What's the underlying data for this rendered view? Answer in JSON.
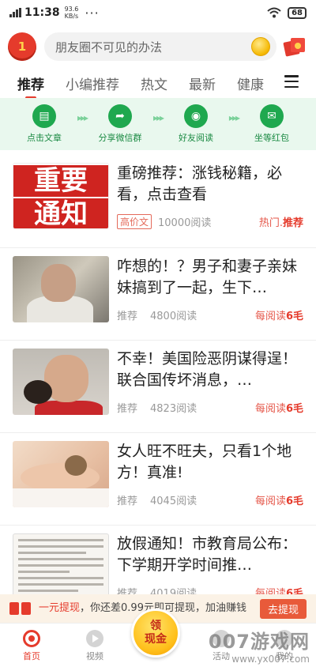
{
  "status_bar": {
    "time": "11:38",
    "net_speed": "93.6",
    "net_unit": "KB/s",
    "dots": "···",
    "battery": "68"
  },
  "header": {
    "logo_text": "1",
    "search_placeholder": "朋友圈不可见的办法"
  },
  "tabs": [
    {
      "label": "推荐",
      "active": true
    },
    {
      "label": "小编推荐"
    },
    {
      "label": "热文"
    },
    {
      "label": "最新"
    },
    {
      "label": "健康"
    }
  ],
  "steps": [
    {
      "label": "点击文章",
      "icon": "document-icon"
    },
    {
      "label": "分享微信群",
      "icon": "share-icon"
    },
    {
      "label": "好友阅读",
      "icon": "eye-icon"
    },
    {
      "label": "坐等红包",
      "icon": "redpacket-icon"
    }
  ],
  "feed": [
    {
      "title": "重磅推荐：涨钱秘籍，必看，点击查看",
      "thumb_text_1": "重要",
      "thumb_text_2": "通知",
      "tag": "高价文",
      "reads": "10000阅读",
      "reward_prefix": "热门.",
      "reward_bold": "推荐"
    },
    {
      "title": "咋想的！？男子和妻子亲妹妹搞到了一起，生下…",
      "tag": "推荐",
      "reads": "4800阅读",
      "reward_prefix": "每阅读",
      "reward_bold": "6毛"
    },
    {
      "title": "不幸！美国险恶阴谋得逞！联合国传坏消息，…",
      "tag": "推荐",
      "reads": "4823阅读",
      "reward_prefix": "每阅读",
      "reward_bold": "6毛"
    },
    {
      "title": "女人旺不旺夫，只看1个地方！真准!",
      "tag": "推荐",
      "reads": "4045阅读",
      "reward_prefix": "每阅读",
      "reward_bold": "6毛"
    },
    {
      "title": "放假通知！市教育局公布：下学期开学时间推…",
      "tag": "推荐",
      "reads": "4019阅读",
      "reward_prefix": "每阅读",
      "reward_bold": "6毛"
    }
  ],
  "banner": {
    "highlight": "一元提现",
    "text": "，你还差0.99元即可提现，加油赚钱",
    "button": "去提现"
  },
  "center_button": {
    "line1": "领",
    "line2": "现金"
  },
  "bottom_nav": [
    {
      "label": "首页",
      "active": true
    },
    {
      "label": "视频"
    },
    {
      "label": ""
    },
    {
      "label": "活动"
    },
    {
      "label": "我的"
    }
  ],
  "watermark": {
    "line1": "007游戏网",
    "line2": "www.yx007.com"
  },
  "colors": {
    "accent": "#e53b2c",
    "step_green": "#1fa84f",
    "step_bg": "#e9f8ee"
  }
}
